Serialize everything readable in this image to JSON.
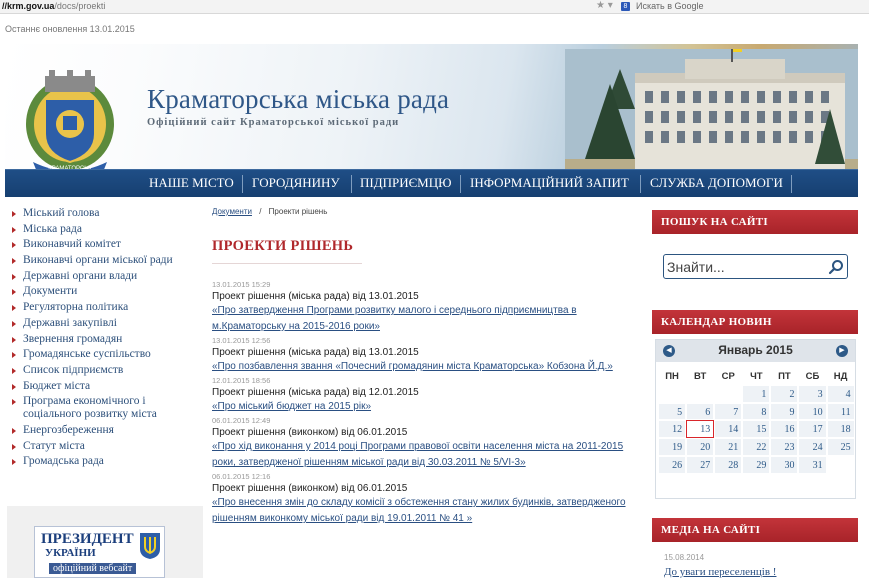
{
  "browser": {
    "url_host": "//krm.gov.ua",
    "url_path": "/docs/proekti",
    "search_placeholder": "Искать в Google"
  },
  "header": {
    "updated": "Останнє оновлення 13.01.2015",
    "title": "Краматорська міська рада",
    "subtitle": "Офіційний сайт Краматорської міської ради",
    "emblem_label": "КРАМАТОРСЬК"
  },
  "nav": {
    "items": [
      "НАШЕ МІСТО",
      "ГОРОДЯНИНУ",
      "ПІДПРИЄМЦЮ",
      "ІНФОРМАЦІЙНИЙ ЗАПИТ",
      "СЛУЖБА ДОПОМОГИ"
    ]
  },
  "sidebar": {
    "items": [
      "Міський голова",
      "Міська рада",
      "Виконавчий комітет",
      "Виконавчі органи міської ради",
      "Державні органи влади",
      "Документи",
      "Регуляторна політика",
      "Державні закупівлі",
      "Звернення громадян",
      "Громадянське суспільство",
      "Список підприємств",
      "Бюджет міста",
      "Програма економічного і соціального розвитку міста",
      "Енергозбереження",
      "Статут міста",
      "Громадська рада"
    ]
  },
  "president": {
    "line1": "ПРЕЗИДЕНТ",
    "line2": "УКРАЇНИ",
    "line3": "офіційний вебсайт"
  },
  "breadcrumb": {
    "root": "Документи",
    "separator": "/",
    "current": "Проекти рішень"
  },
  "page_title": "ПРОЕКТИ РІШЕНЬ",
  "documents": [
    {
      "date": "13.01.2015 15:29",
      "head": "Проект рішення (міська рада) від 13.01.2015",
      "link": "«Про затвердження Програми розвитку малого і середнього підприємництва в м.Краматорську на 2015-2016 роки»"
    },
    {
      "date": "13.01.2015 12:56",
      "head": "Проект рішення (міська рада) від 13.01.2015",
      "link": "«Про позбавлення звання «Почесний громадянин міста Краматорська» Кобзона Й.Д.»"
    },
    {
      "date": "12.01.2015 18:56",
      "head": "Проект рішення (міська рада) від 12.01.2015",
      "link": "«Про міський бюджет на 2015 рік»"
    },
    {
      "date": "06.01.2015 12:49",
      "head": "Проект рішення (виконком) від 06.01.2015",
      "link": "«Про хід виконання у 2014 році Програми правової освіти населення міста на 2011-2015 роки, затвердженої рішенням міської ради від 30.03.2011 № 5/VI-3»"
    },
    {
      "date": "06.01.2015 12:16",
      "head": "Проект рішення (виконком) від 06.01.2015",
      "link": "«Про внесення змін до складу комісії з обстеження стану жилих будинків, затвердженого рішенням виконкому міської ради від 19.01.2011 № 41 »"
    }
  ],
  "right": {
    "search_heading": "ПОШУК НА САЙТІ",
    "search_placeholder": "Знайти...",
    "calendar_heading": "КАЛЕНДАР НОВИН",
    "calendar_title": "Январь 2015",
    "calendar_dow": [
      "ПН",
      "ВТ",
      "СР",
      "ЧТ",
      "ПТ",
      "СБ",
      "НД"
    ],
    "calendar_weeks": [
      [
        "",
        "",
        "",
        "1",
        "2",
        "3",
        "4"
      ],
      [
        "5",
        "6",
        "7",
        "8",
        "9",
        "10",
        "11"
      ],
      [
        "12",
        "13",
        "14",
        "15",
        "16",
        "17",
        "18"
      ],
      [
        "19",
        "20",
        "21",
        "22",
        "23",
        "24",
        "25"
      ],
      [
        "26",
        "27",
        "28",
        "29",
        "30",
        "31",
        ""
      ]
    ],
    "calendar_today": "13",
    "media_heading": "МЕДІА НА САЙТІ",
    "media_date": "15.08.2014",
    "media_link": "До уваги переселенців !"
  },
  "colors": {
    "accent_red": "#b0282c",
    "nav_blue": "#1f4e86",
    "link_blue": "#2a4f82"
  }
}
